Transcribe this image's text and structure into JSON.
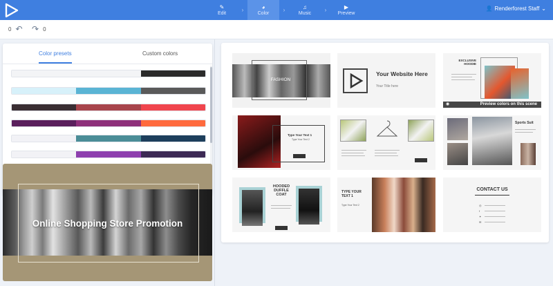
{
  "app": {
    "user_name": "Renderforest Staff"
  },
  "steps": [
    {
      "label": "Edit",
      "icon": "✎"
    },
    {
      "label": "Color",
      "icon": "◕"
    },
    {
      "label": "Music",
      "icon": "♫"
    },
    {
      "label": "Preview",
      "icon": "▶"
    }
  ],
  "history": {
    "undo_count": "0",
    "redo_count": "0"
  },
  "color_tabs": {
    "presets": "Color presets",
    "custom": "Custom colors"
  },
  "palettes": [
    [
      "#f3f4f6",
      "#f3f4f6",
      "#2b2b2b"
    ],
    [
      "#d7f1fa",
      "#5ab4d4",
      "#5a5a5a"
    ],
    [
      "#3a2e33",
      "#a8454c",
      "#f0454d"
    ],
    [
      "#5a1f5c",
      "#8e2f7a",
      "#ff6a3d"
    ],
    [
      "#f2f2f6",
      "#4b8d97",
      "#1d3f5c"
    ],
    [
      "#f2f2f6",
      "#8d3fae",
      "#3d2a55"
    ]
  ],
  "preview": {
    "title": "Online Shopping Store Promotion"
  },
  "scenes": {
    "s1_label": "FASHION",
    "s2_title": "Your Website Here",
    "s2_sub": "Your Title here",
    "s3_title": "EXCLUSIVE HOODIE",
    "s3_overlay": "Preview colors on this scene",
    "s4_title": "Type Your Text 1",
    "s4_sub": "Type Your Text 2",
    "s6_title": "Sports Suit",
    "s7_title": "HOODED DUFFLE COAT",
    "s8_title": "TYPE YOUR TEXT 1",
    "s8_sub": "Type Your Text 2",
    "s9_title": "CONTACT US"
  },
  "colors": {
    "accent": "#3f7fe0",
    "topbar": "#3f7fe0"
  }
}
